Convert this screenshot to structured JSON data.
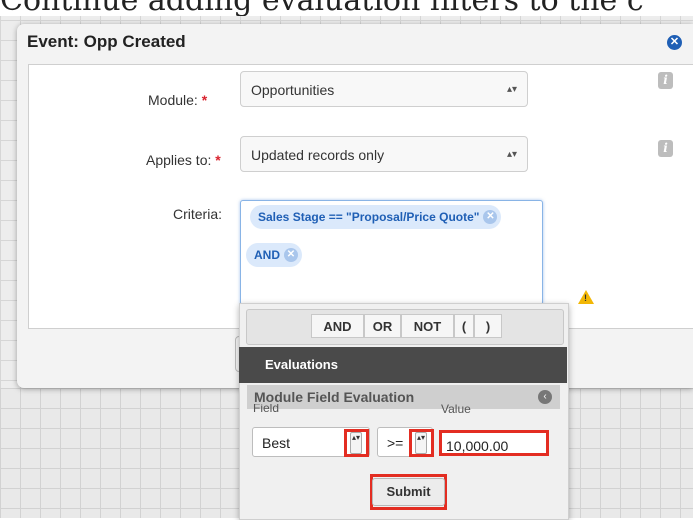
{
  "caption": "Continue adding evaluation filters to the c",
  "dialog": {
    "title": "Event: Opp Created",
    "close_glyph": "✕"
  },
  "form": {
    "module_label": "Module:",
    "module_value": "Opportunities",
    "applies_label": "Applies to:",
    "applies_value": "Updated records only",
    "criteria_label": "Criteria:",
    "required_mark": "*",
    "info_glyph": "i"
  },
  "criteria": {
    "pills": [
      {
        "text": "Sales Stage == \"Proposal/Price Quote\""
      },
      {
        "text": "AND"
      }
    ],
    "remove_glyph": "✕"
  },
  "builder": {
    "operators": [
      "AND",
      "OR",
      "NOT",
      "(",
      ")"
    ],
    "evaluations_title": "Evaluations",
    "module_field_title": "Module Field Evaluation",
    "field_label": "Field",
    "value_label": "Value",
    "field_value": "Best",
    "operator_value": ">=",
    "value_input": "10,000.00",
    "submit_label": "Submit",
    "collapse_glyph": "‹"
  },
  "colors": {
    "accent": "#1f5fb5",
    "highlight": "#e32d22",
    "warning": "#f2b705"
  },
  "icons": {
    "select_arrows": "▴▾",
    "warning": "!"
  }
}
